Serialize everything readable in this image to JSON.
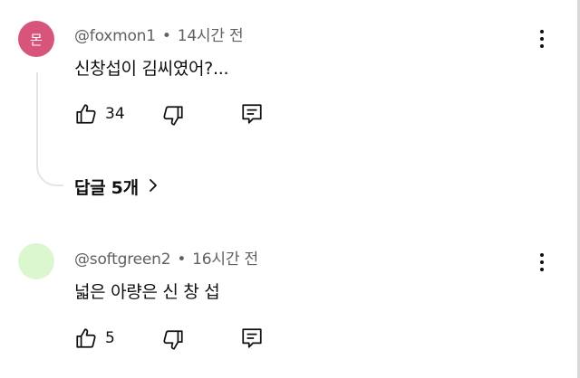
{
  "comments": [
    {
      "avatar_text": "몬",
      "avatar_color": "#d9547a",
      "author": "@foxmon1",
      "separator": "•",
      "time": "14시간 전",
      "text": "신창섭이 김씨였어?...",
      "likes": "34",
      "replies_label": "답글 5개"
    },
    {
      "avatar_text": "",
      "avatar_color": "#daf7cf",
      "author": "@softgreen2",
      "separator": "•",
      "time": "16시간 전",
      "text": "넓은 아량은 신 창 섭",
      "likes": "5"
    }
  ],
  "icons": {
    "like": "thumbs-up-icon",
    "dislike": "thumbs-down-icon",
    "reply": "reply-icon",
    "menu": "more-vertical-icon",
    "chevron": "chevron-right-icon"
  }
}
